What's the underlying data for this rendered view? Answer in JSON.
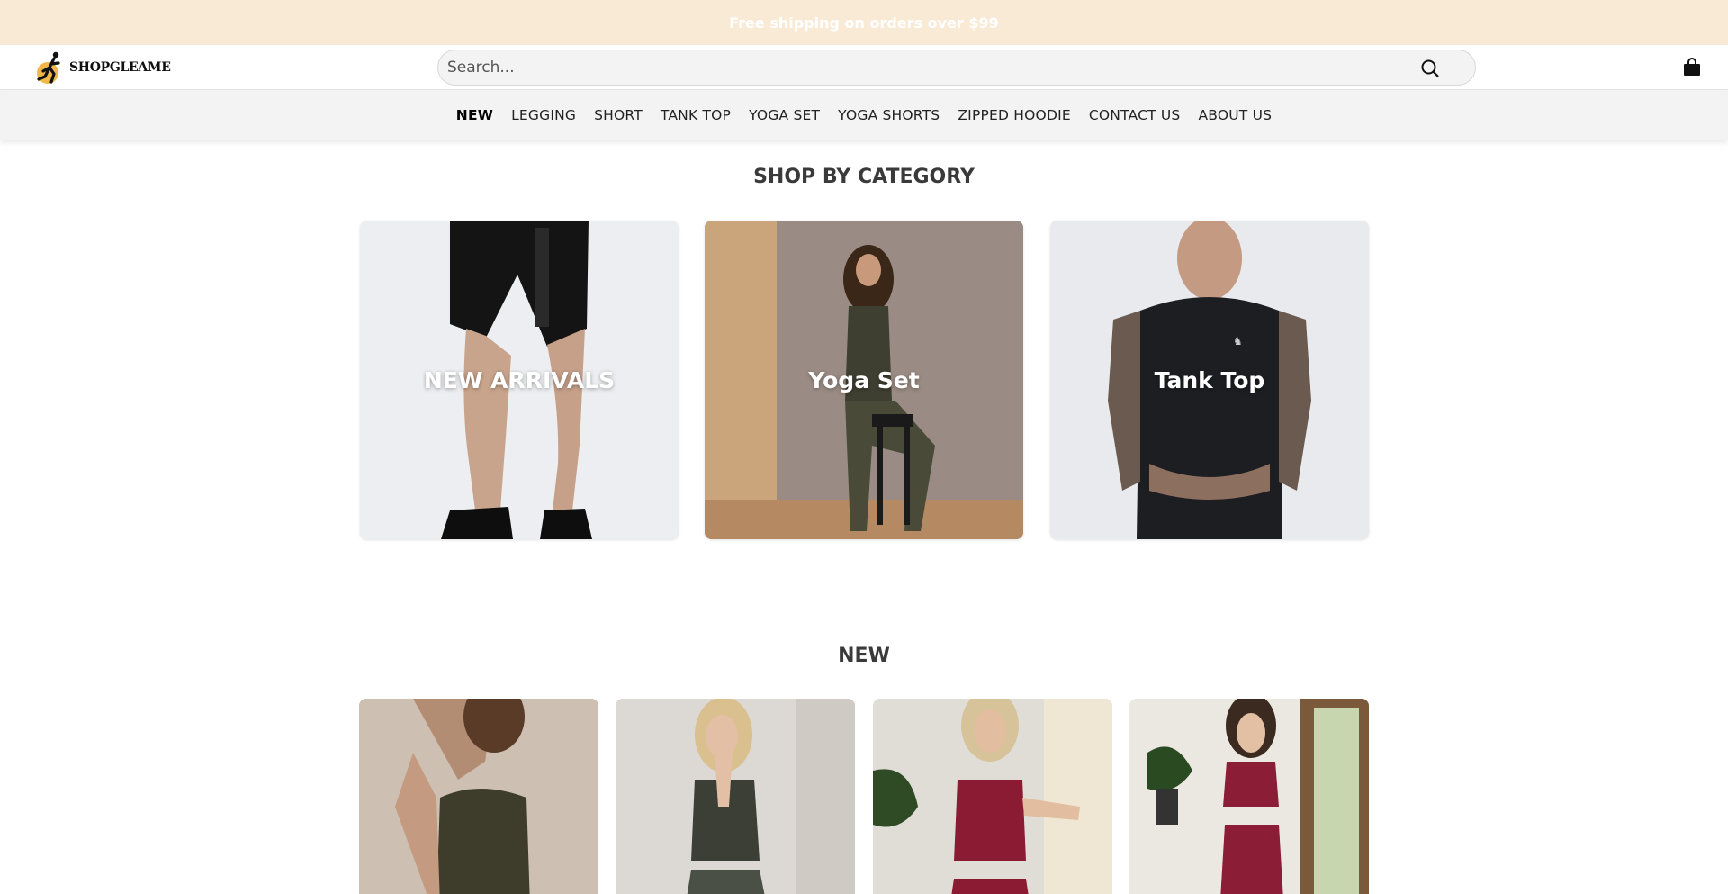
{
  "announcement": "Free shipping on orders over $99",
  "brand": {
    "name": "SHOPGLEAME"
  },
  "search": {
    "placeholder": "Search..."
  },
  "icons": {
    "search": "search-icon",
    "cart": "shopping-bag-icon"
  },
  "nav": {
    "items": [
      {
        "label": "NEW",
        "active": true
      },
      {
        "label": "LEGGING"
      },
      {
        "label": "SHORT"
      },
      {
        "label": "TANK TOP"
      },
      {
        "label": "YOGA SET"
      },
      {
        "label": "YOGA SHORTS"
      },
      {
        "label": "ZIPPED HOODIE"
      },
      {
        "label": "CONTACT US"
      },
      {
        "label": "ABOUT US"
      }
    ]
  },
  "categories": {
    "title": "SHOP BY CATEGORY",
    "items": [
      {
        "label": "NEW ARRIVALS"
      },
      {
        "label": "Yoga Set"
      },
      {
        "label": "Tank Top"
      }
    ]
  },
  "new_section": {
    "title": "NEW"
  },
  "colors": {
    "announcement_bg": "#f9ead6",
    "nav_bg": "#f3f3f3"
  }
}
